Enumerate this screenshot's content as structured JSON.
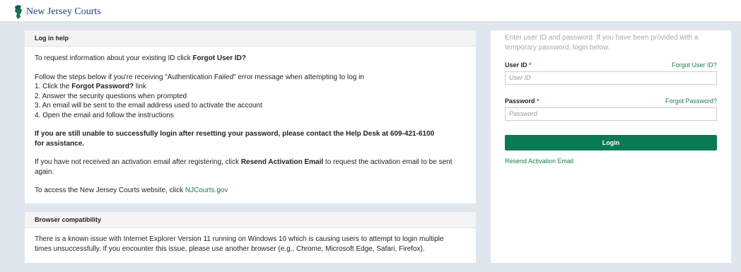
{
  "header": {
    "brand": "New Jersey Courts"
  },
  "help_panel": {
    "title": "Log in help",
    "line1_prefix": "To request information about your existing ID click ",
    "line1_bold": "Forgot User ID?",
    "steps_intro": "Follow the steps below if you're receiving \"Authentication Failed\" error message when attempting to log in",
    "step1_prefix": "1. Click the ",
    "step1_bold": "Forgot Password?",
    "step1_suffix": " link",
    "step2": "2. Answer the security questions when prompted",
    "step3": "3. An email will be sent to the email address used to activate the account",
    "step4": "4. Open the email and follow the instructions",
    "notice": "If you are still unable to successfully login after resetting your password, please contact the Help Desk at 609-421-6100 for assistance.",
    "activation_prefix": "If you have not received an activation email after registering, click ",
    "activation_bold": "Resend Activation Email",
    "activation_suffix": " to request the activation email to be sent again.",
    "website_prefix": "To access the New Jersey Courts website, click ",
    "website_link": "NJCourts.gov"
  },
  "compat_panel": {
    "title": "Browser compatibility",
    "text": "There is a known issue with Internet Explorer Version 11 running on Windows 10 which is causing users to attempt to login multiple times unsuccessfully. If you encounter this issue, please use another browser (e.g., Chrome, Microsoft Edge, Safari, Firefox)."
  },
  "login_form": {
    "intro": "Enter user ID and password. If you have been provided with a temporary password, login below.",
    "user_label": "User ID",
    "required_mark": "*",
    "forgot_user": "Forgot User ID?",
    "user_placeholder": "User ID",
    "password_label": "Password",
    "forgot_password": "Forgot Password?",
    "password_placeholder": "Password",
    "login_button": "Login",
    "resend_link": "Resend Activation Email"
  },
  "colors": {
    "accent": "#0a7a55",
    "link": "#1d7a4f",
    "brand": "#1f3f7a",
    "background": "#dfe6ee"
  }
}
